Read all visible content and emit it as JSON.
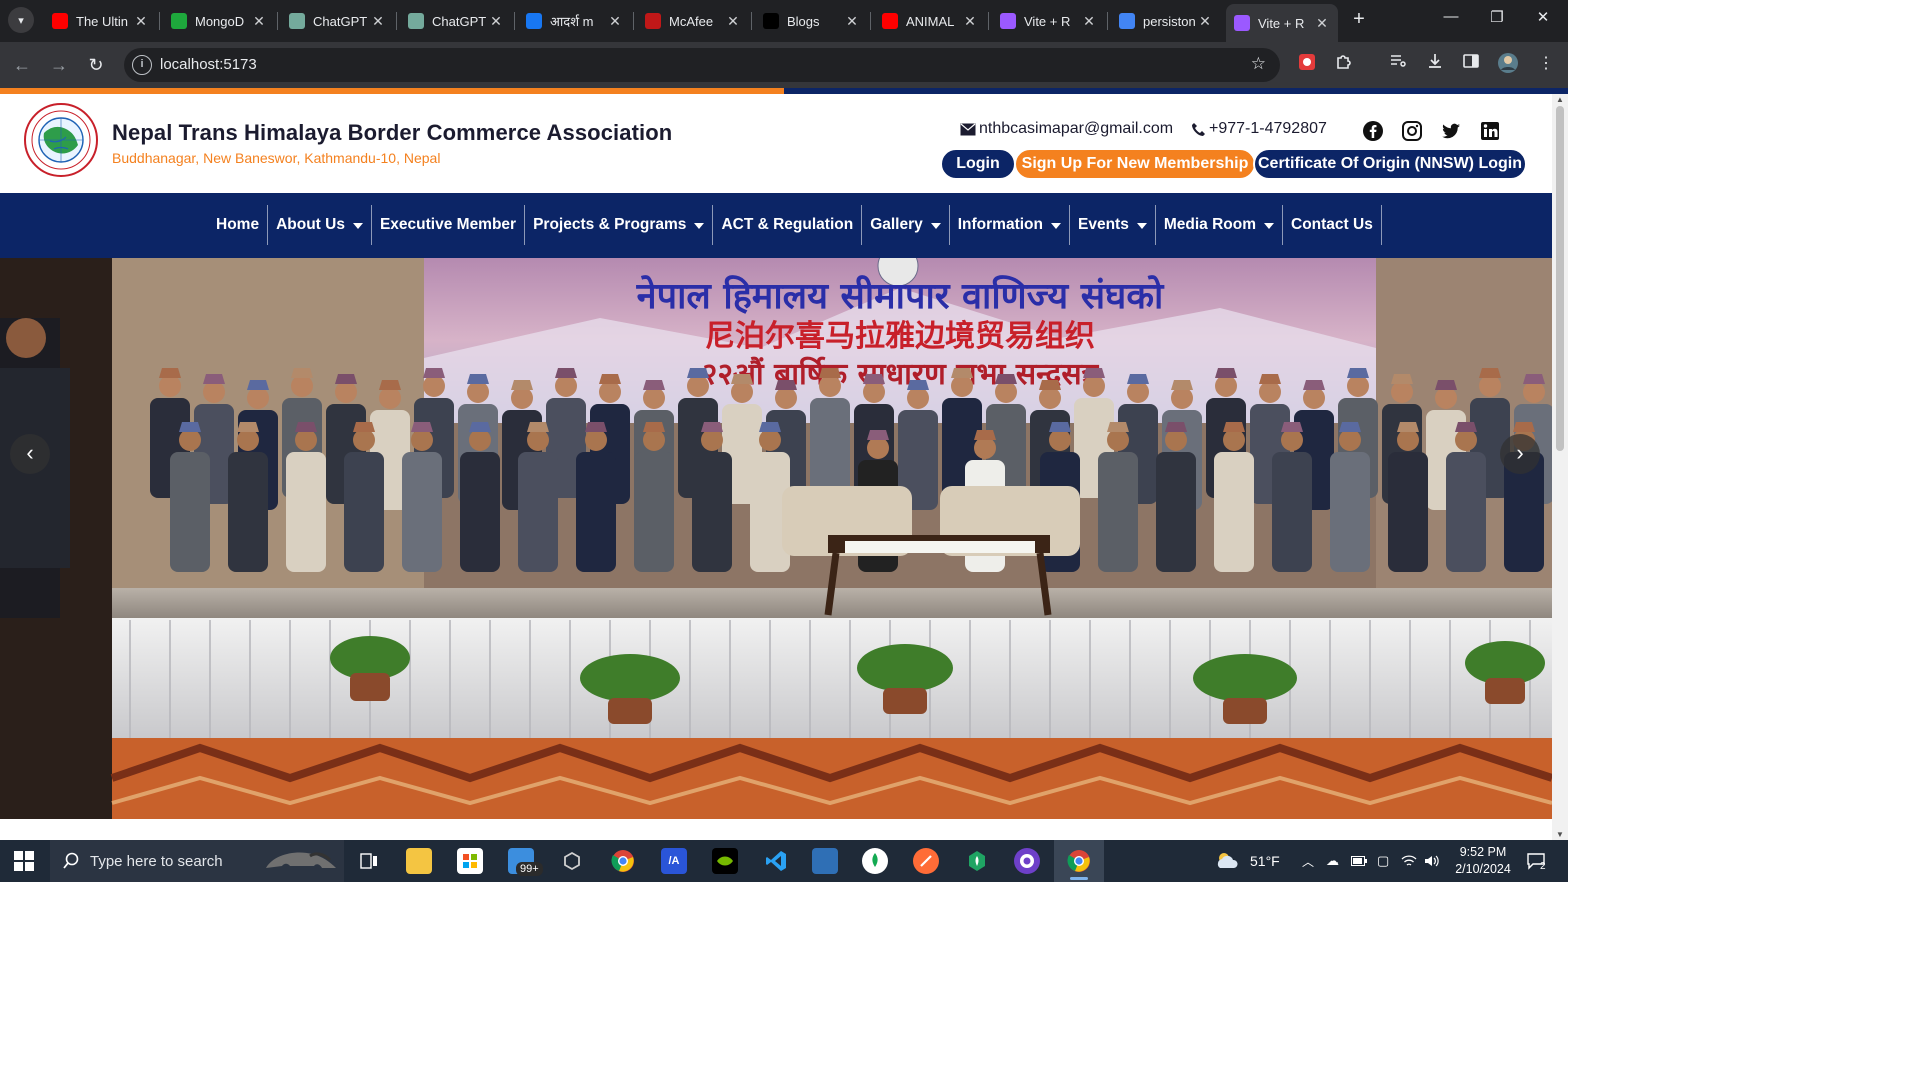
{
  "browser": {
    "tabs": [
      {
        "title": "The Ultin",
        "icon": "youtube-icon",
        "color": "#ff0000"
      },
      {
        "title": "MongoD",
        "icon": "w-icon",
        "color": "#1ea83c"
      },
      {
        "title": "ChatGPT",
        "icon": "chatgpt-icon",
        "color": "#74aa9c"
      },
      {
        "title": "ChatGPT",
        "icon": "chatgpt-icon",
        "color": "#74aa9c"
      },
      {
        "title": "आदर्श m",
        "icon": "facebook-icon",
        "color": "#1877f2"
      },
      {
        "title": "McAfee",
        "icon": "mcafee-icon",
        "color": "#c01818"
      },
      {
        "title": "Blogs",
        "icon": "blogs-icon",
        "color": "#000000"
      },
      {
        "title": "ANIMAL",
        "icon": "youtube-icon",
        "color": "#ff0000"
      },
      {
        "title": "Vite + R",
        "icon": "vite-icon",
        "color": "#9b59ff"
      },
      {
        "title": "persiston",
        "icon": "google-icon",
        "color": "#4285f4"
      },
      {
        "title": "Vite + R",
        "icon": "vite-icon",
        "color": "#9b59ff",
        "active": true
      }
    ],
    "url": "localhost:5173",
    "load_progress": 0.5
  },
  "site": {
    "title": "Nepal Trans Himalaya Border Commerce Association",
    "address": "Buddhanagar, New Baneswor, Kathmandu-10, Nepal",
    "email": "nthbcasimapar@gmail.com",
    "phone": "+977-1-4792807",
    "buttons": {
      "login": "Login",
      "signup": "Sign Up For New Membership",
      "certificate": "Certificate Of Origin (NNSW) Login"
    },
    "nav": [
      {
        "label": "Home",
        "dropdown": false
      },
      {
        "label": "About Us",
        "dropdown": true
      },
      {
        "label": "Executive Member",
        "dropdown": false
      },
      {
        "label": "Projects & Programs",
        "dropdown": true
      },
      {
        "label": "ACT & Regulation",
        "dropdown": false
      },
      {
        "label": "Gallery",
        "dropdown": true
      },
      {
        "label": "Information",
        "dropdown": true
      },
      {
        "label": "Events",
        "dropdown": true
      },
      {
        "label": "Media Room",
        "dropdown": true
      },
      {
        "label": "Contact Us",
        "dropdown": false
      }
    ],
    "hero": {
      "banner_line1": "नेपाल हिमालय सीमापार वाणिज्य संघको",
      "banner_line2": "尼泊尔喜马拉雅边境贸易组织",
      "banner_line3": "२२औं बार्षिक साधारण सभा सन्दसत्र",
      "prev": "‹",
      "next": "›"
    },
    "colors": {
      "navy": "#0c2566",
      "orange": "#f4811f"
    }
  },
  "taskbar": {
    "search_placeholder": "Type here to search",
    "mail_badge": "99+",
    "weather": "51°F",
    "time": "9:52 PM",
    "date": "2/10/2024",
    "notifications": "2"
  }
}
